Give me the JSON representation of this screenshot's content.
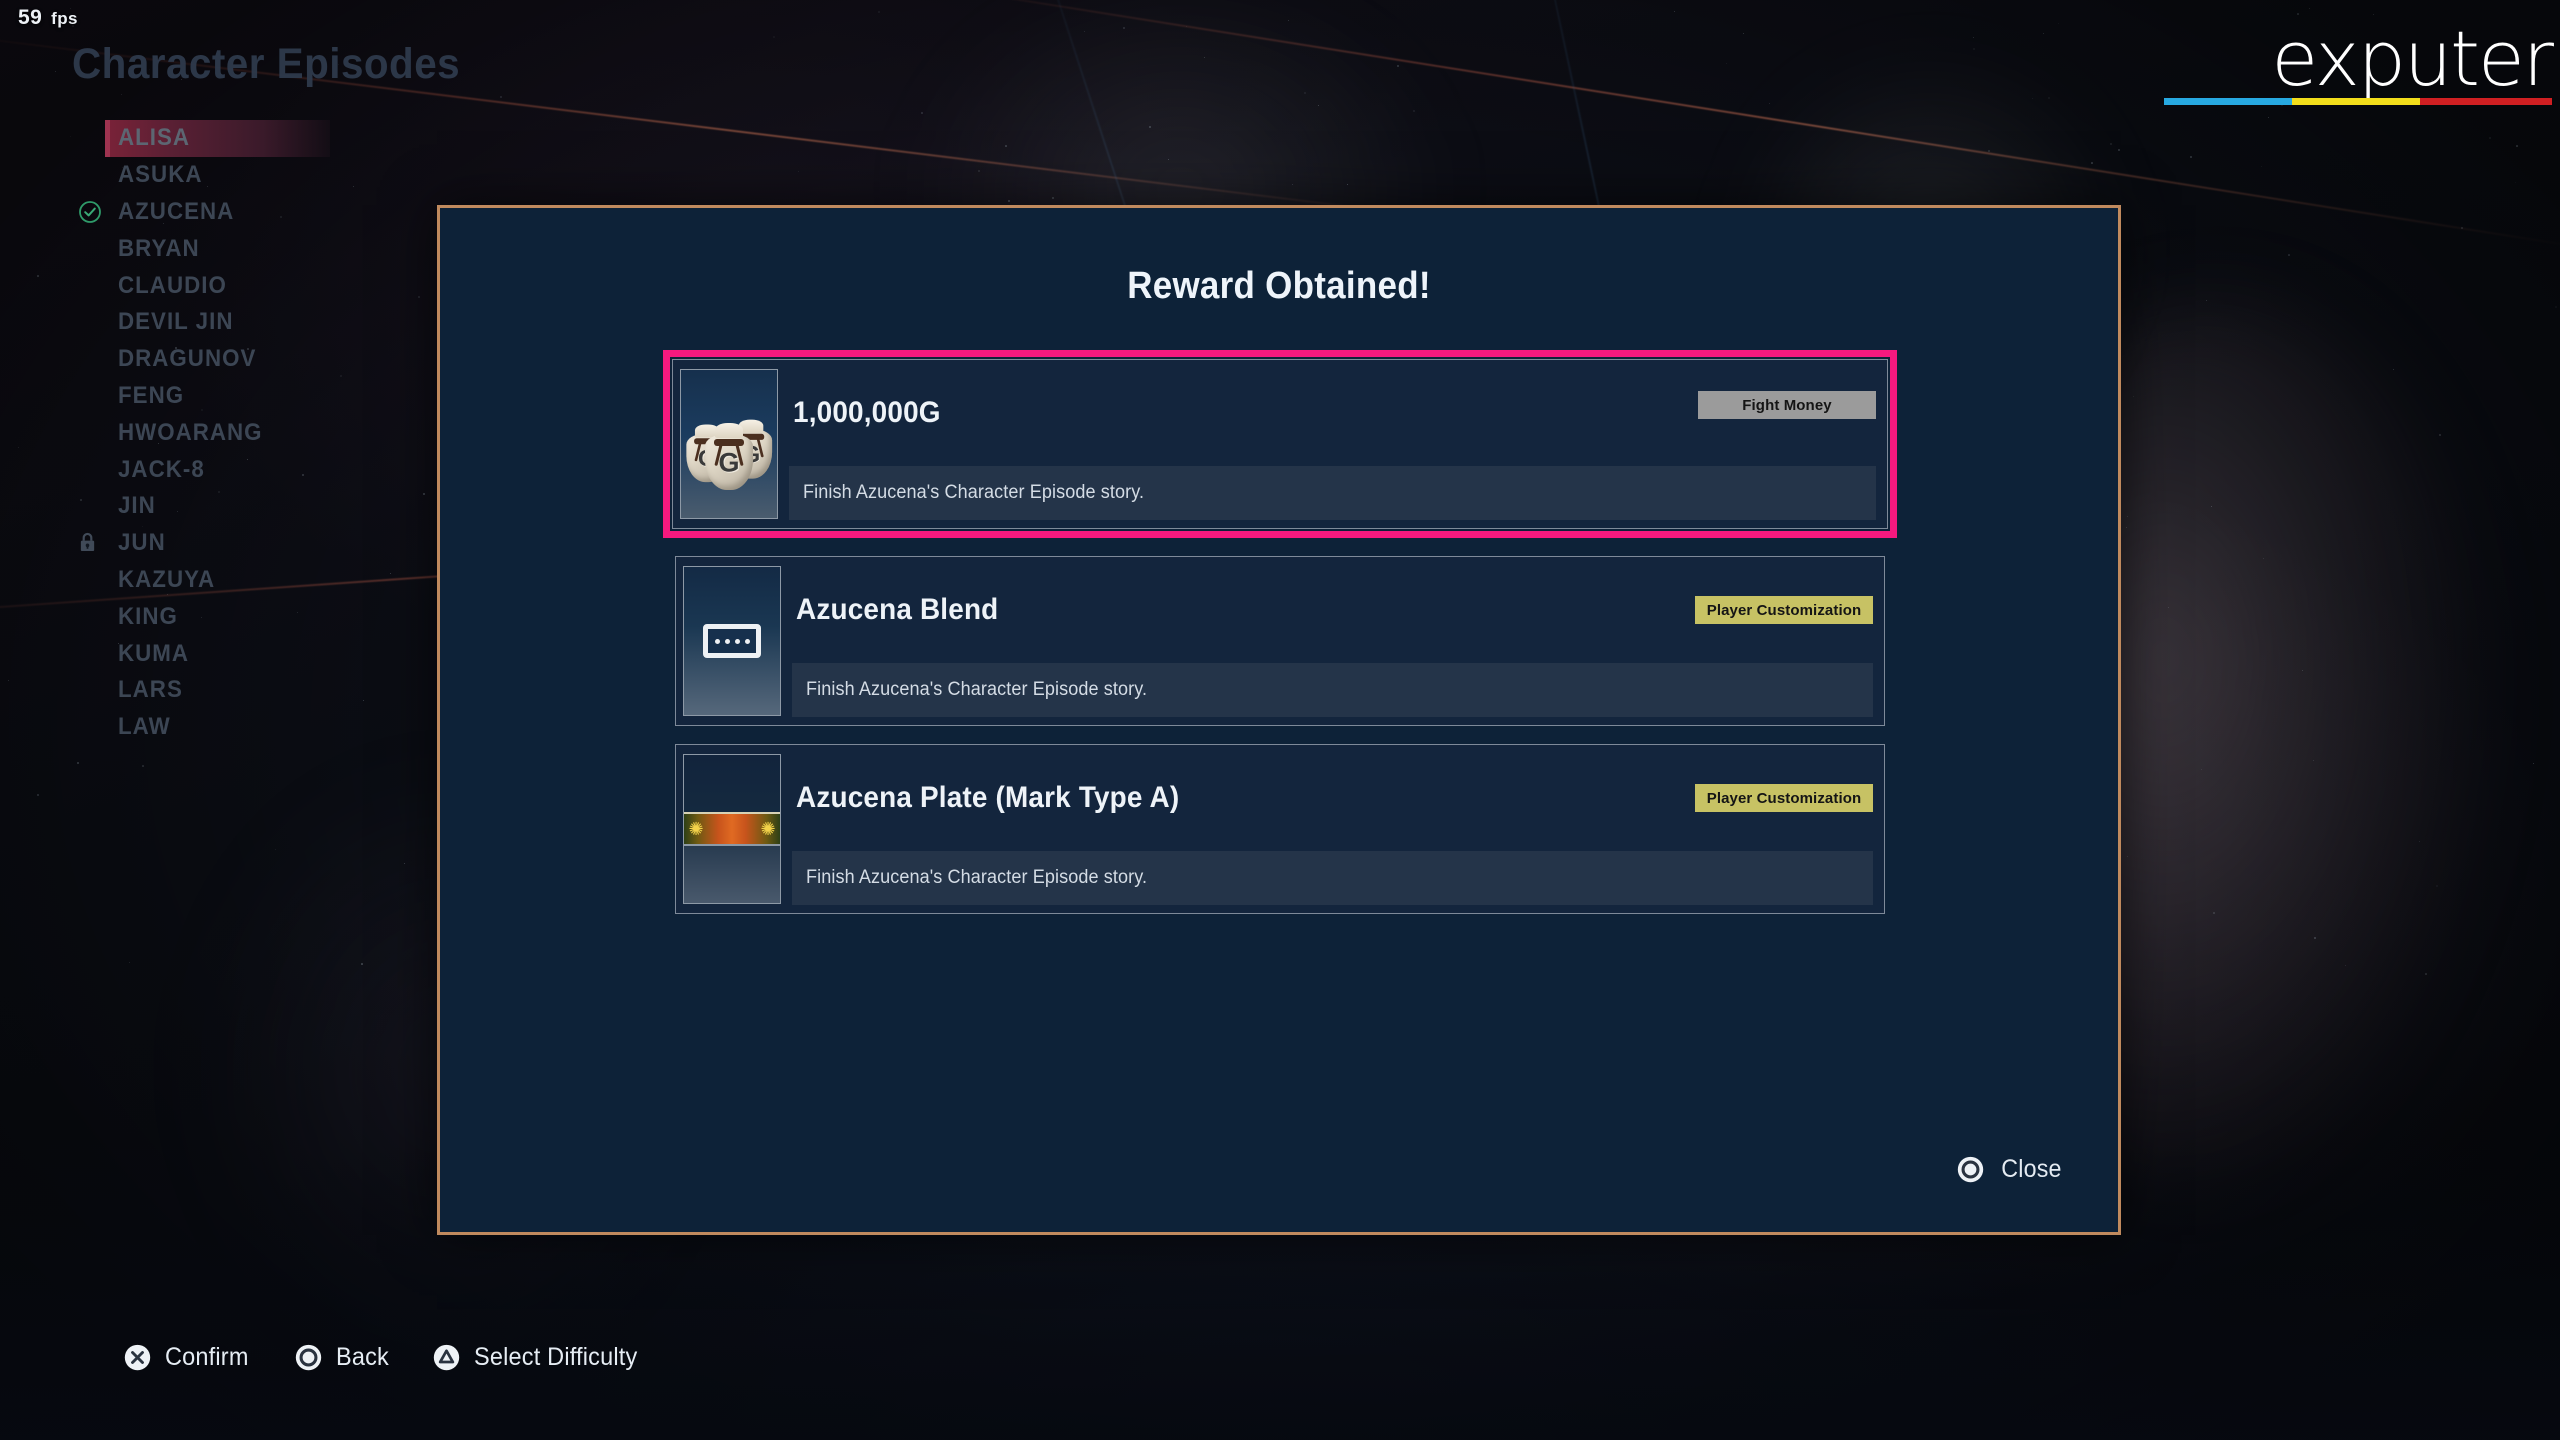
{
  "hud": {
    "fps_value": "59",
    "fps_unit": "fps"
  },
  "page": {
    "title": "Character Episodes"
  },
  "branding": {
    "logo_text": "exputer",
    "bar_colors": [
      "#27a9e1",
      "#f2dd1b",
      "#cf1f22"
    ]
  },
  "sidebar": {
    "items": [
      {
        "label": "ALISA",
        "state": "selected",
        "mark": "none"
      },
      {
        "label": "ASUKA",
        "state": "normal",
        "mark": "none"
      },
      {
        "label": "AZUCENA",
        "state": "normal",
        "mark": "check-circle-icon"
      },
      {
        "label": "BRYAN",
        "state": "normal",
        "mark": "none"
      },
      {
        "label": "CLAUDIO",
        "state": "normal",
        "mark": "none"
      },
      {
        "label": "DEVIL JIN",
        "state": "normal",
        "mark": "none"
      },
      {
        "label": "DRAGUNOV",
        "state": "normal",
        "mark": "none"
      },
      {
        "label": "FENG",
        "state": "normal",
        "mark": "none"
      },
      {
        "label": "HWOARANG",
        "state": "normal",
        "mark": "none"
      },
      {
        "label": "JACK-8",
        "state": "normal",
        "mark": "none"
      },
      {
        "label": "JIN",
        "state": "normal",
        "mark": "none"
      },
      {
        "label": "JUN",
        "state": "locked",
        "mark": "lock-icon"
      },
      {
        "label": "KAZUYA",
        "state": "normal",
        "mark": "none"
      },
      {
        "label": "KING",
        "state": "normal",
        "mark": "none"
      },
      {
        "label": "KUMA",
        "state": "normal",
        "mark": "none"
      },
      {
        "label": "LARS",
        "state": "normal",
        "mark": "none"
      },
      {
        "label": "LAW",
        "state": "normal",
        "mark": "none"
      }
    ]
  },
  "modal": {
    "title": "Reward Obtained!",
    "border_color": "#c08a5e",
    "background_color": "#0d2238",
    "highlight_color": "#f5197e",
    "close": {
      "label": "Close",
      "icon": "ps-circle-icon"
    },
    "rewards": [
      {
        "name": "1,000,000G",
        "description": "Finish Azucena's Character Episode story.",
        "badge": "Fight Money",
        "badge_color": "#9b9b9b",
        "icon": "money-bag-icon",
        "highlighted": true
      },
      {
        "name": "Azucena Blend",
        "description": "Finish Azucena's Character Episode story.",
        "badge": "Player Customization",
        "badge_color": "#c7c264",
        "icon": "item-card-icon",
        "highlighted": false
      },
      {
        "name": "Azucena Plate (Mark Type A)",
        "description": "Finish Azucena's Character Episode story.",
        "badge": "Player Customization",
        "badge_color": "#c7c264",
        "icon": "name-plate-icon",
        "highlighted": false
      }
    ]
  },
  "bottom_bar": {
    "hints": [
      {
        "label": "Confirm",
        "icon": "ps-cross-icon"
      },
      {
        "label": "Back",
        "icon": "ps-circle-icon"
      },
      {
        "label": "Select Difficulty",
        "icon": "ps-triangle-icon"
      }
    ]
  }
}
